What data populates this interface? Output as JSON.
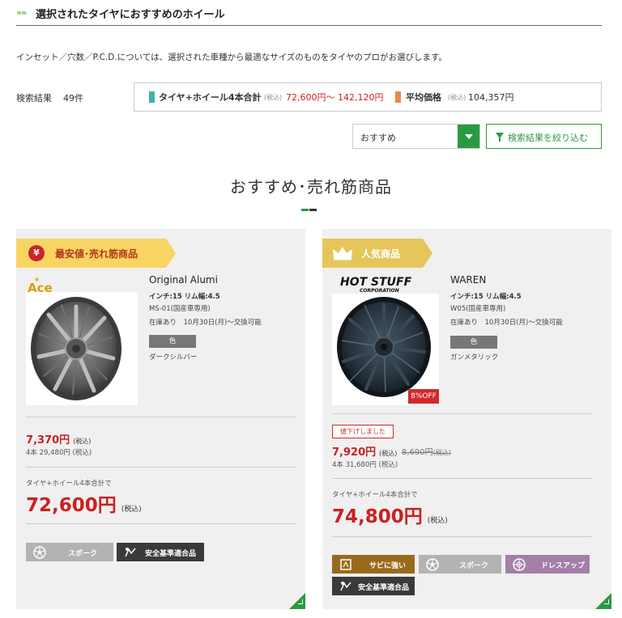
{
  "section": {
    "title": "選択されたタイヤにおすすめのホイール",
    "intro": "インセット／穴数／P.C.D.については、選択された車種から最適なサイズのものをタイヤのプロがお選びします。"
  },
  "results": {
    "label": "検索結果",
    "count": "49件"
  },
  "summary": {
    "total_label": "タイヤ+ホイール4本合計",
    "tax_note": "(税込)",
    "total_range": "72,600円～ 142,120円",
    "avg_label": "平均価格",
    "avg_tax_note": "(税込)",
    "avg_price": "104,357円"
  },
  "controls": {
    "sort_value": "おすすめ",
    "filter_label": "検索結果を絞り込む"
  },
  "recommend": {
    "title": "おすすめ･売れ筋商品"
  },
  "products": [
    {
      "badge": "最安値･売れ筋商品",
      "brand": "Ace",
      "name": "Original Alumi",
      "spec": "インチ:15 リム幅:4.5",
      "model": "MS-01(国産車専用)",
      "stock": "在庫あり　10月30日(月)～交換可能",
      "color_label": "色",
      "color_name": "ダークシルバー",
      "unit_price": "7,370円",
      "tax": "(税込)",
      "four_price": "4本 29,480円 (税込)",
      "total_label": "タイヤ+ホイール4本合計で",
      "total_price": "72,600円",
      "tags": [
        {
          "label": "スポーク",
          "icon": "spoke-wheel-icon",
          "color": "#b3b3b3"
        },
        {
          "label": "安全基準適合品",
          "icon": "safety-icon",
          "color": "#3a3a3a"
        }
      ]
    },
    {
      "badge": "人気商品",
      "brand": "HOT STUFF",
      "brand_sub": "CORPORATION",
      "name": "WAREN",
      "spec": "インチ:15 リム幅:4.5",
      "model": "W05(国産車専用)",
      "stock": "在庫あり　10月30日(月)～交換可能",
      "color_label": "色",
      "color_name": "ガンメタリック",
      "discount": "8%OFF",
      "price_down": "値下げしました",
      "unit_price": "7,920円",
      "tax": "(税込)",
      "old_price": "8,690円",
      "old_tax": "(税込)",
      "four_price": "4本 31,680円 (税込)",
      "total_label": "タイヤ+ホイール4本合計で",
      "total_price": "74,800円",
      "tags": [
        {
          "label": "サビに強い",
          "icon": "rust-resist-icon",
          "color": "#9a6a1c"
        },
        {
          "label": "スポーク",
          "icon": "spoke-wheel-icon",
          "color": "#b3b3b3"
        },
        {
          "label": "ドレスアップ",
          "icon": "dressup-wheel-icon",
          "color": "#a47fa8"
        },
        {
          "label": "安全基準適合品",
          "icon": "safety-icon",
          "color": "#3a3a3a"
        }
      ]
    }
  ],
  "colors": {
    "accent_green": "#2a9a42",
    "price_red": "#cc2020",
    "badge_yellow": "#f8d463"
  }
}
